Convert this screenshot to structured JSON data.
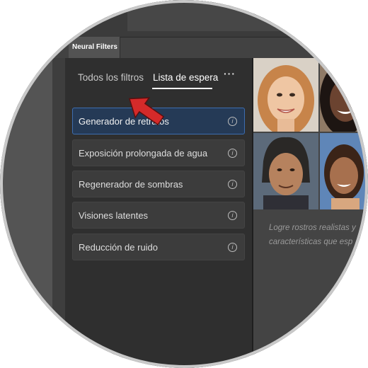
{
  "app": {
    "document_tab": "Neural Filters"
  },
  "tabs": [
    {
      "label": "Todos los filtros",
      "active": false
    },
    {
      "label": "Lista de espera",
      "active": true
    }
  ],
  "more_label": "···",
  "filters": [
    {
      "label": "Generador de retratos",
      "selected": true
    },
    {
      "label": "Exposición prolongada de agua",
      "selected": false
    },
    {
      "label": "Regenerador de sombras",
      "selected": false
    },
    {
      "label": "Visiones latentes",
      "selected": false
    },
    {
      "label": "Reducción de ruido",
      "selected": false
    }
  ],
  "info_glyph": "i",
  "preview": {
    "description_line1": "Logre rostros realistas y",
    "description_line2": "características que esp"
  },
  "colors": {
    "accent_selected": "#253a56",
    "arrow": "#d42a2a"
  }
}
